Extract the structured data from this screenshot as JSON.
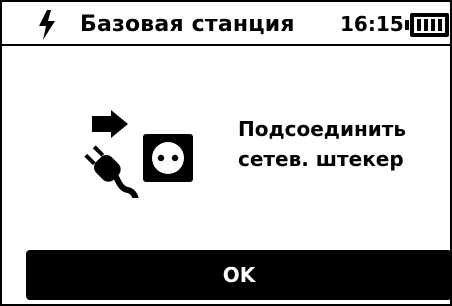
{
  "status_bar": {
    "title": "Базовая станция",
    "time": "16:15",
    "power_icon": "lightning-bolt-icon",
    "battery_icon": "battery-icon"
  },
  "message": {
    "icon": "power-plug-to-socket-icon",
    "line1": "Подсоединить",
    "line2": "сетев. штекер"
  },
  "actions": {
    "ok_label": "OK"
  }
}
